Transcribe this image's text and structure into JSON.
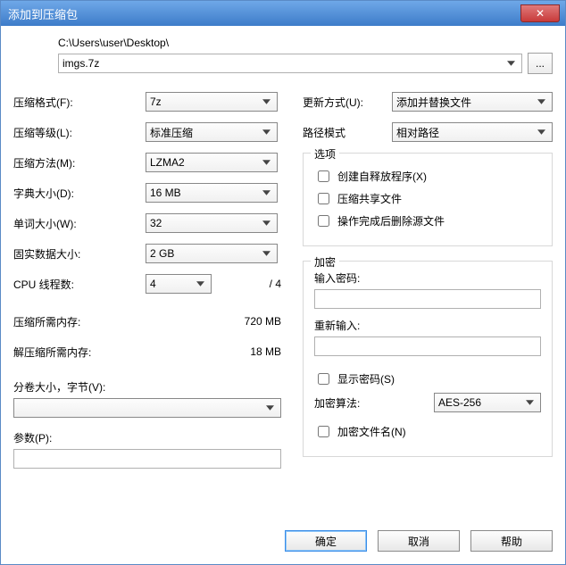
{
  "window": {
    "title": "添加到压缩包",
    "close_glyph": "✕"
  },
  "path": "C:\\Users\\user\\Desktop\\",
  "archive_name": "imgs.7z",
  "browse_label": "...",
  "left": {
    "format_label": "压缩格式(F):",
    "format_value": "7z",
    "level_label": "压缩等级(L):",
    "level_value": "标准压缩",
    "method_label": "压缩方法(M):",
    "method_value": "LZMA2",
    "dict_label": "字典大小(D):",
    "dict_value": "16 MB",
    "word_label": "单词大小(W):",
    "word_value": "32",
    "solid_label": "固实数据大小:",
    "solid_value": "2 GB",
    "threads_label": "CPU 线程数:",
    "threads_value": "4",
    "threads_max": "/ 4",
    "mem_comp_label": "压缩所需内存:",
    "mem_comp_value": "720 MB",
    "mem_decomp_label": "解压缩所需内存:",
    "mem_decomp_value": "18 MB",
    "split_label": "分卷大小，字节(V):",
    "params_label": "参数(P):"
  },
  "right": {
    "update_label": "更新方式(U):",
    "update_value": "添加并替换文件",
    "pathmode_label": "路径模式",
    "pathmode_value": "相对路径",
    "options_title": "选项",
    "opt_sfx": "创建自释放程序(X)",
    "opt_shared": "压缩共享文件",
    "opt_delete": "操作完成后删除源文件",
    "enc_title": "加密",
    "pwd_label": "输入密码:",
    "pwd2_label": "重新输入:",
    "showpwd": "显示密码(S)",
    "enc_method_label": "加密算法:",
    "enc_method_value": "AES-256",
    "enc_names": "加密文件名(N)"
  },
  "buttons": {
    "ok": "确定",
    "cancel": "取消",
    "help": "帮助"
  }
}
